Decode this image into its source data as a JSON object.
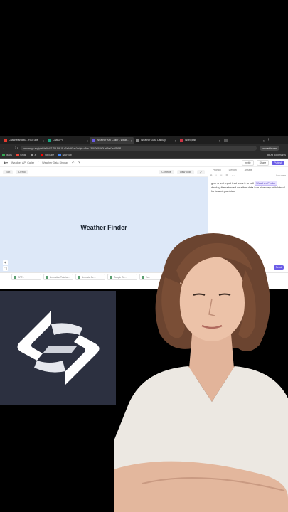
{
  "browser": {
    "tabs": [
      {
        "label": "ChannelandMu - YouTube",
        "color": "#e33b2e",
        "active": false
      },
      {
        "label": "ChatGPT",
        "color": "#19a37f",
        "active": false
      },
      {
        "label": "Weather API Caller - Weathe",
        "color": "#6b5ce7",
        "active": true
      },
      {
        "label": "Weather Data Display",
        "color": "#888888",
        "active": false
      },
      {
        "label": "Wordpost",
        "color": "#cc3344",
        "active": false
      },
      {
        "label": "",
        "color": "#555555",
        "active": false
      }
    ],
    "url": "readmega.app/p/ab4e66d37-79f-9f4f-8f-d7e5d4f2ac?origin=c5ce-7/55/f0d5/8b0f-ab9a-f7e6f3d5f5",
    "sync_label": "Account in sync",
    "bookmarks": [
      "Maps",
      "Gmail",
      "ai",
      "YouTube",
      "New Tab"
    ],
    "bookmarks_right": "All Bookmarks"
  },
  "app": {
    "breadcrumb_1": "Weather API Caller",
    "breadcrumb_2": "Weather Data Display",
    "invite_label": "Invite",
    "share_label": "Share",
    "publish_label": "Publish",
    "edit_chip": "Edit",
    "mode_chip": "Demo",
    "controls_label": "Controls",
    "view_code_label": "View code"
  },
  "preview": {
    "title": "Weather Finder"
  },
  "panel": {
    "tabs": [
      "Prompt",
      "Design",
      "Assets"
    ],
    "tools": [
      "B",
      "I",
      "U",
      "☰",
      "⋯"
    ],
    "tools_right": "Auto save",
    "prompt_before": "give a text input that uses it to  call ",
    "prompt_highlight": "Weather Finder",
    "prompt_after": " display the returned weather data in a nice way with lots of fonts and graphics",
    "send_label": "Send"
  },
  "filetabs": [
    "GPT...",
    "Animation Tutorial...",
    "Animate Ge...",
    "Google Ge...",
    "Yo..."
  ],
  "colors": {
    "accent": "#6b5ce7",
    "preview_bg": "#dde8f8",
    "logo_bg": "#2c3040"
  }
}
